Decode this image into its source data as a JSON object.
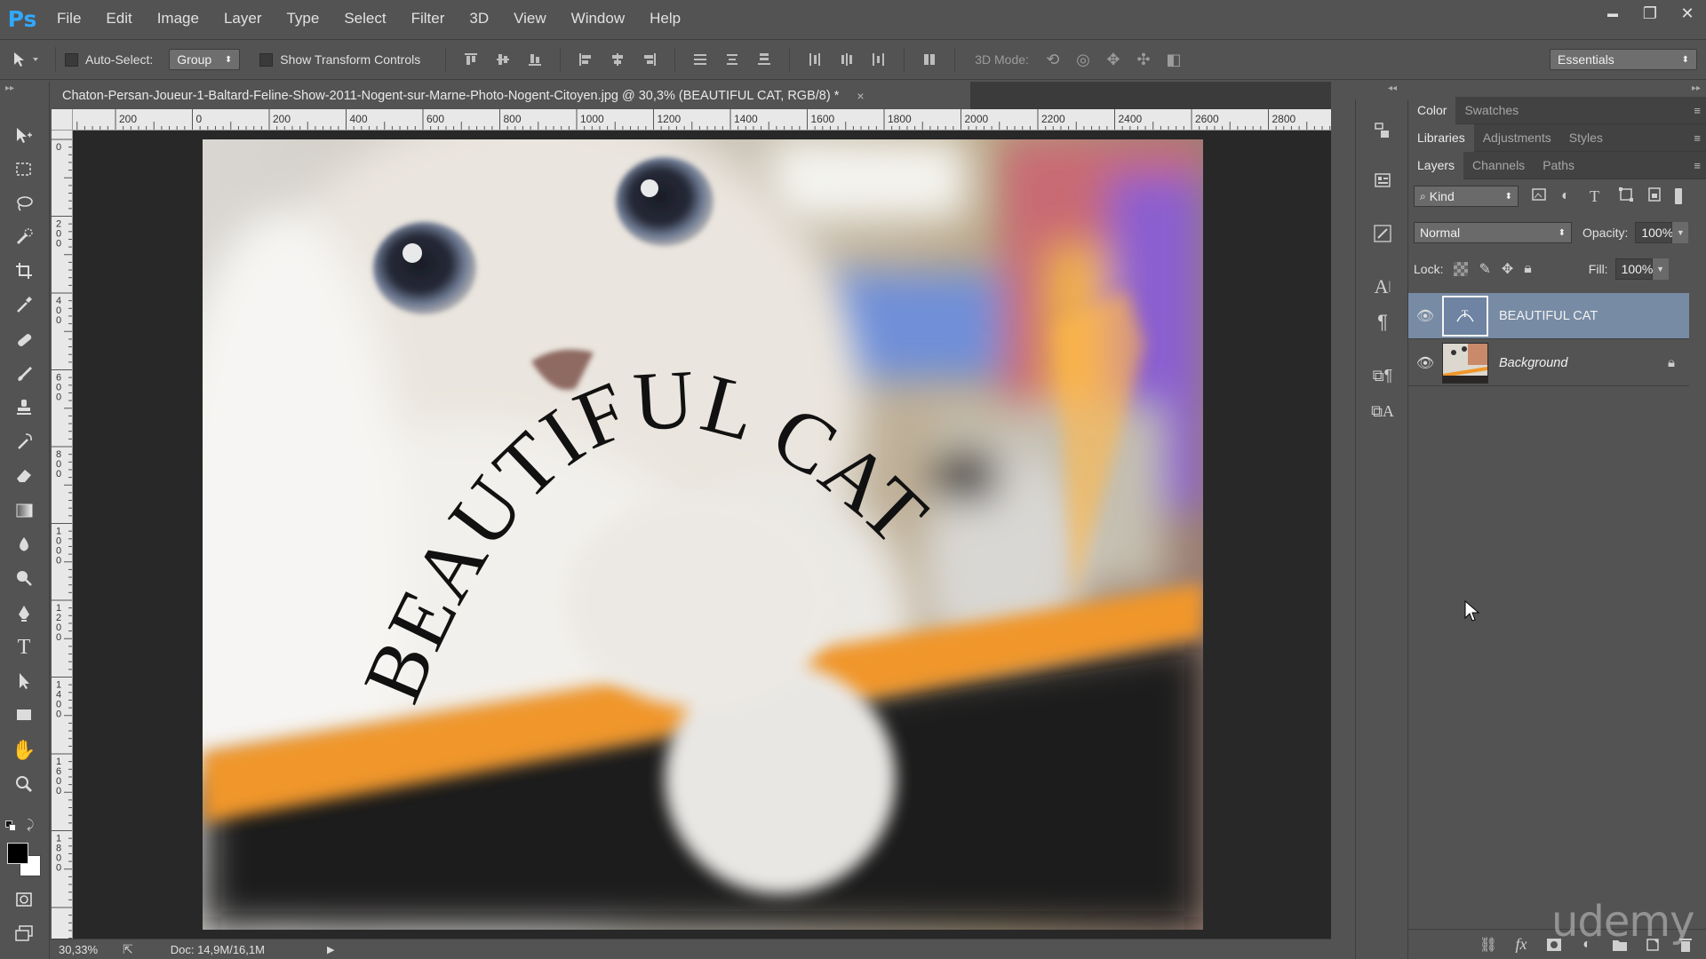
{
  "app": {
    "logo": "Ps"
  },
  "menu": [
    "File",
    "Edit",
    "Image",
    "Layer",
    "Type",
    "Select",
    "Filter",
    "3D",
    "View",
    "Window",
    "Help"
  ],
  "window_controls": {
    "minimize": "▬",
    "restore": "❐",
    "close": "✕"
  },
  "options_bar": {
    "auto_select_label": "Auto-Select:",
    "auto_select_value": "Group",
    "show_transform_label": "Show Transform Controls",
    "mode_3d_label": "3D Mode:",
    "workspace": "Essentials"
  },
  "document": {
    "tab_title": "Chaton-Persan-Joueur-1-Baltard-Feline-Show-2011-Nogent-sur-Marne-Photo-Nogent-Citoyen.jpg @ 30,3% (BEAUTIFUL CAT, RGB/8) *",
    "close_glyph": "×",
    "warped_text": "BEAUTIFUL CAT",
    "ruler_top_labels": [
      "200",
      "0",
      "200",
      "400",
      "600",
      "800",
      "1000",
      "1200",
      "1400",
      "1600",
      "1800",
      "2000",
      "2200",
      "2400",
      "2600",
      "2800"
    ],
    "ruler_left_labels": [
      "0",
      "200",
      "400",
      "600",
      "800",
      "1000",
      "1200",
      "1400",
      "1600",
      "1800"
    ]
  },
  "status_bar": {
    "zoom": "30,33%",
    "doc_info": "Doc: 14,9M/16,1M"
  },
  "panels": {
    "top_tabs": [
      "Color",
      "Swatches"
    ],
    "mid_tabs": [
      "Libraries",
      "Adjustments",
      "Styles"
    ],
    "layer_tabs": [
      "Layers",
      "Channels",
      "Paths"
    ],
    "filter_kind": "Kind",
    "blend_mode": "Normal",
    "opacity_label": "Opacity:",
    "opacity_value": "100%",
    "lock_label": "Lock:",
    "fill_label": "Fill:",
    "fill_value": "100%",
    "layers": [
      {
        "name": "BEAUTIFUL CAT",
        "selected": true
      },
      {
        "name": "Background",
        "selected": false,
        "locked": true
      }
    ],
    "footer_icons": [
      "link-icon",
      "fx-icon",
      "mask-icon",
      "adjustment-icon",
      "folder-icon",
      "new-layer-icon",
      "trash-icon"
    ],
    "fx_label": "fx"
  },
  "watermark": "udemy",
  "colors": {
    "selected_layer": "#788ba5",
    "ps_blue": "#31a8ff",
    "orange_rail": "#f0962a"
  }
}
